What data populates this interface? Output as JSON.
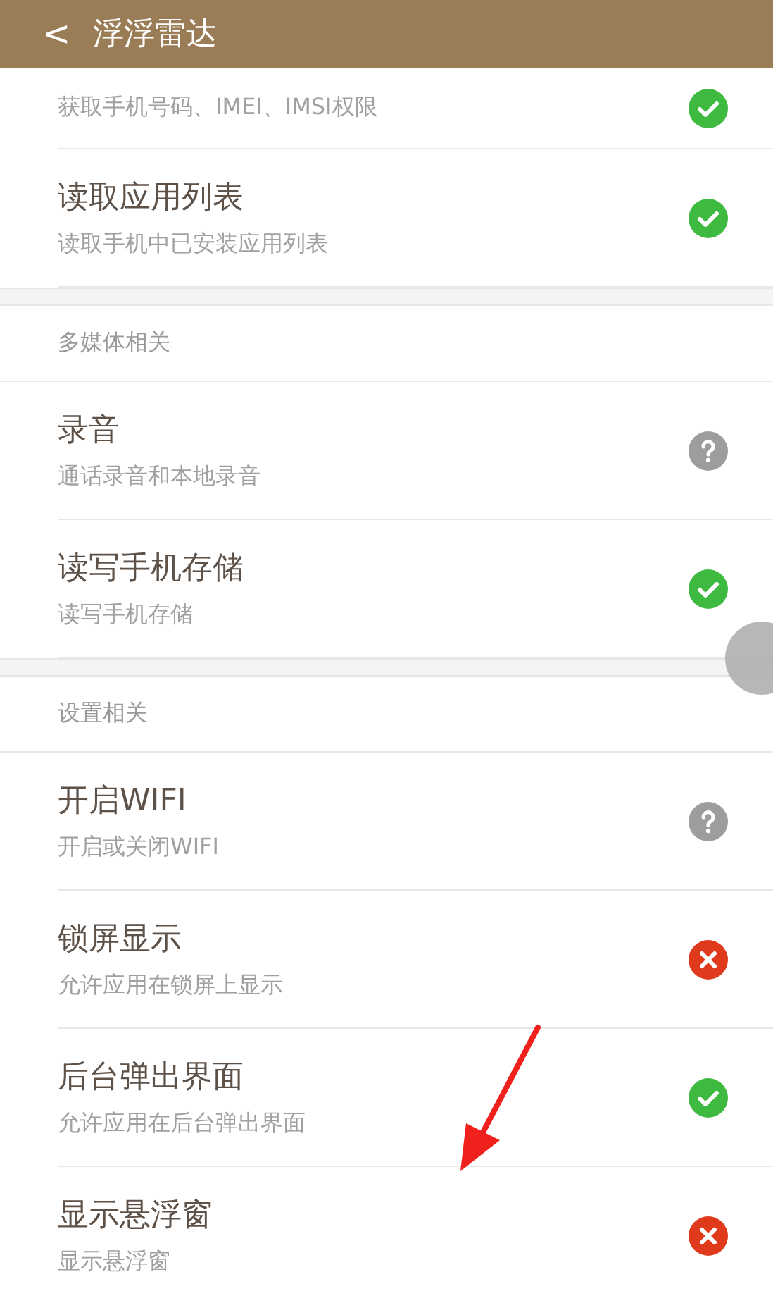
{
  "header": {
    "back": "<",
    "title": "浮浮雷达"
  },
  "sections": [
    {
      "items": [
        {
          "subtitle": "获取手机号码、IMEI、IMSI权限",
          "kind": "granted"
        },
        {
          "title": "读取应用列表",
          "subtitle": "读取手机中已安装应用列表",
          "kind": "granted"
        }
      ]
    },
    {
      "title": "多媒体相关",
      "items": [
        {
          "title": "录音",
          "subtitle": "通话录音和本地录音",
          "kind": "ask"
        },
        {
          "title": "读写手机存储",
          "subtitle": "读写手机存储",
          "kind": "granted"
        }
      ]
    },
    {
      "title": "设置相关",
      "items": [
        {
          "title": "开启WIFI",
          "subtitle": "开启或关闭WIFI",
          "kind": "ask"
        },
        {
          "title": "锁屏显示",
          "subtitle": "允许应用在锁屏上显示",
          "kind": "denied"
        },
        {
          "title": "后台弹出界面",
          "subtitle": "允许应用在后台弹出界面",
          "kind": "granted"
        },
        {
          "title": "显示悬浮窗",
          "subtitle": "显示悬浮窗",
          "kind": "denied"
        }
      ]
    }
  ]
}
